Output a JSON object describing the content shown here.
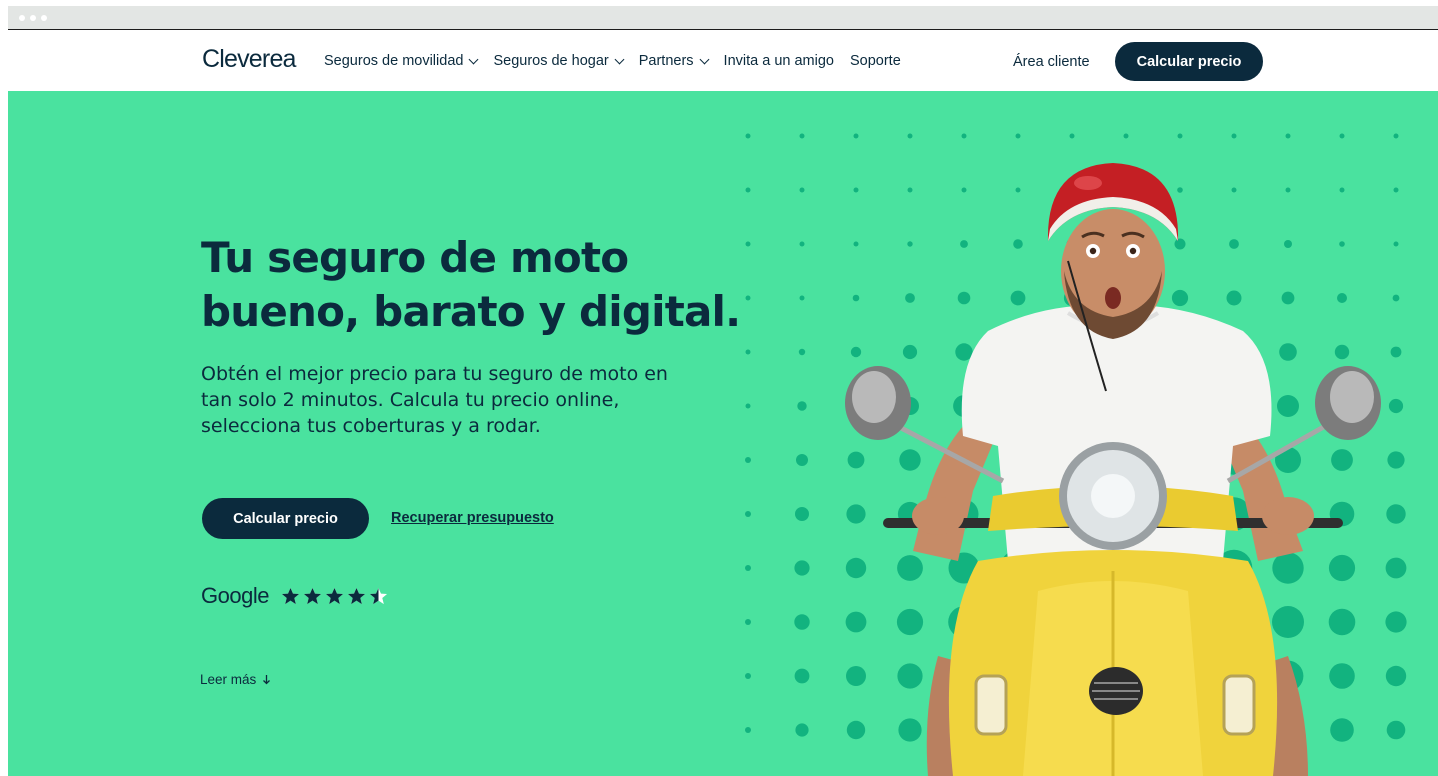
{
  "header": {
    "logo": "Cleverea",
    "nav": [
      {
        "label": "Seguros de movilidad",
        "has_dropdown": true
      },
      {
        "label": "Seguros de hogar",
        "has_dropdown": true
      },
      {
        "label": "Partners",
        "has_dropdown": true
      },
      {
        "label": "Invita a un amigo",
        "has_dropdown": false
      },
      {
        "label": "Soporte",
        "has_dropdown": false
      }
    ],
    "client_area": "Área cliente",
    "cta": "Calcular precio"
  },
  "hero": {
    "title_line1": "Tu seguro de moto",
    "title_line2": "bueno, barato y digital.",
    "subtitle": "Obtén el mejor precio para tu seguro de moto en tan solo 2 minutos. Calcula tu precio online, selecciona tus coberturas y a rodar.",
    "cta": "Calcular precio",
    "recover_link": "Recuperar presupuesto",
    "rating_source": "Google",
    "rating_stars": 4.5,
    "read_more": "Leer más"
  },
  "colors": {
    "brand_green": "#4ae29f",
    "dot_green": "#12b37f",
    "navy": "#0b2a3d",
    "scooter_yellow": "#f0d33c",
    "helmet_red": "#c41f24"
  }
}
